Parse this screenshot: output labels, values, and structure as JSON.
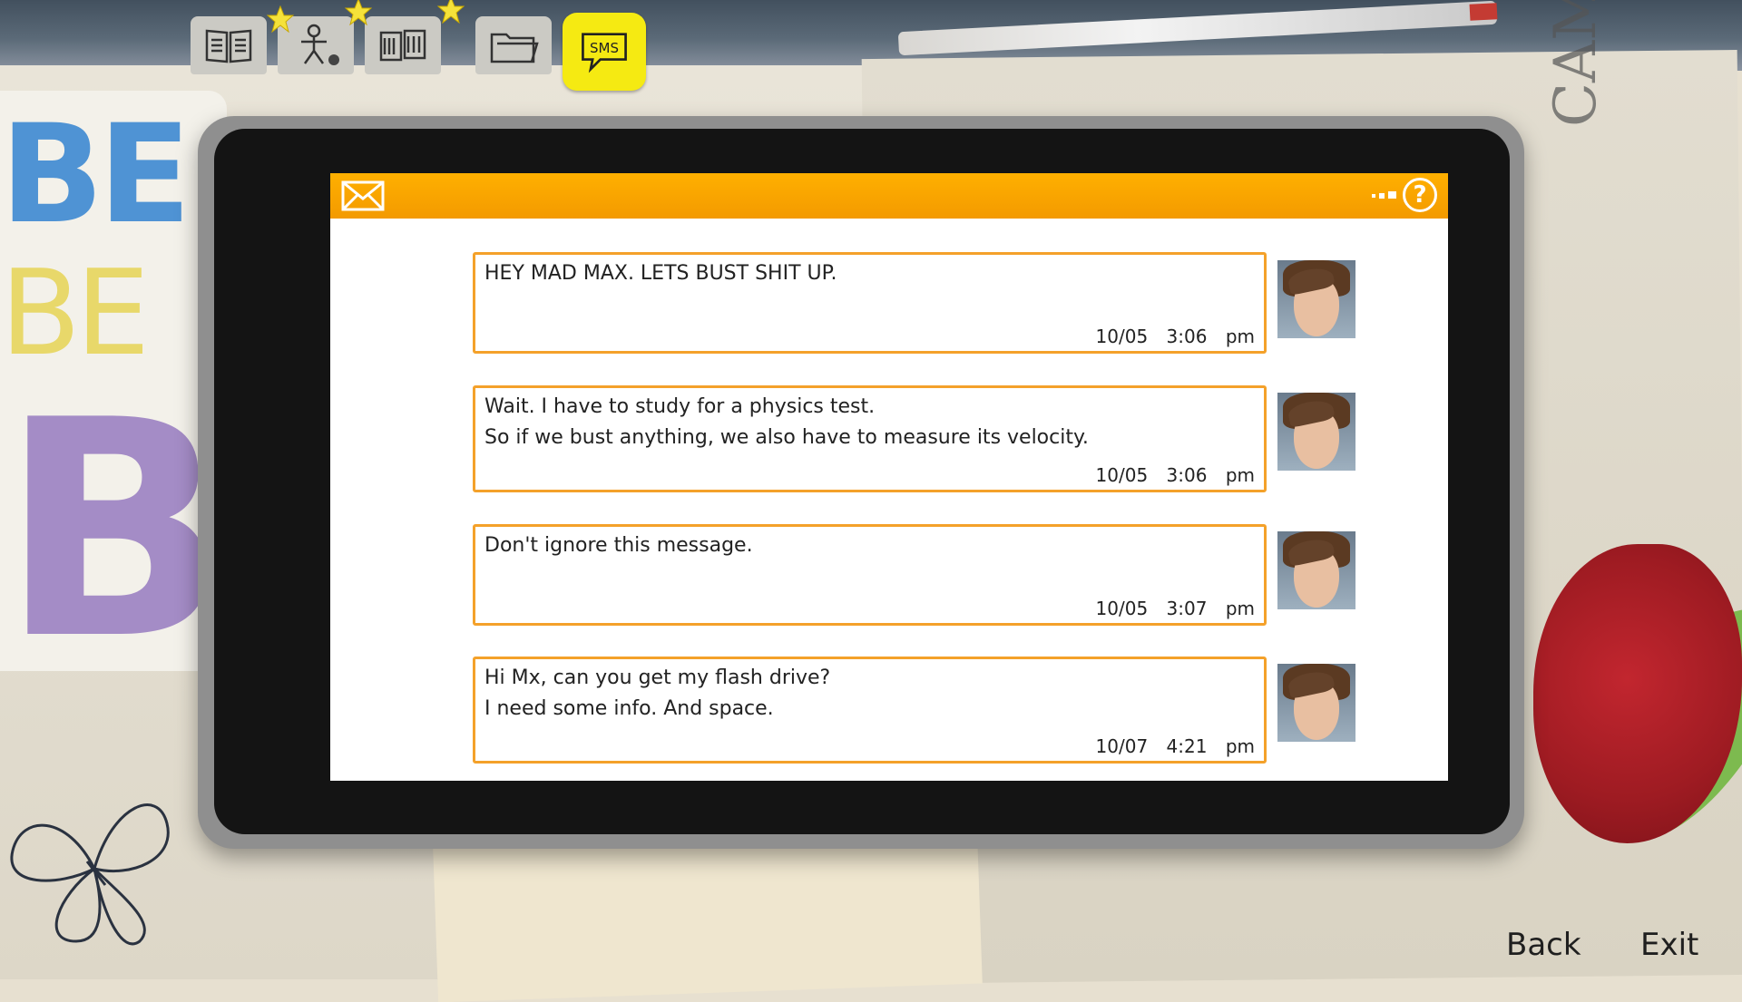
{
  "tabs": [
    {
      "name": "journal",
      "icon": "open-book-icon"
    },
    {
      "name": "characters",
      "icon": "stick-figure-icon"
    },
    {
      "name": "photos",
      "icon": "photo-collection-icon"
    },
    {
      "name": "documents",
      "icon": "folder-icon"
    },
    {
      "name": "sms",
      "icon": "sms-bubble-icon",
      "label": "SMS",
      "active": true
    }
  ],
  "background": {
    "sticker_letters": [
      "BE",
      "BE",
      "BI"
    ],
    "doodle_text": "CAMERA LIAR, A MAGICIAN"
  },
  "header": {
    "left_icon": "envelope-icon",
    "right_icons": [
      "signal-dots-icon",
      "help-icon"
    ],
    "help_label": "?"
  },
  "messages": [
    {
      "text": "HEY MAD MAX. LETS BUST SHIT UP.",
      "date": "10/05",
      "time": "3:06 pm"
    },
    {
      "text": "Wait. I have to study for a physics test.\nSo if we bust anything, we also have to measure its velocity.",
      "date": "10/05",
      "time": "3:06 pm"
    },
    {
      "text": "Don't ignore this message.",
      "date": "10/05",
      "time": "3:07 pm"
    },
    {
      "text": "Hi Mx, can you get my flash drive?\nI need some info. And space.",
      "date": "10/07",
      "time": "4:21 pm"
    }
  ],
  "menu": {
    "back_label": "Back",
    "exit_label": "Exit"
  },
  "colors": {
    "accent": "#f4a12a",
    "header": "#f39a00",
    "sms_tab": "#f5ea12"
  }
}
